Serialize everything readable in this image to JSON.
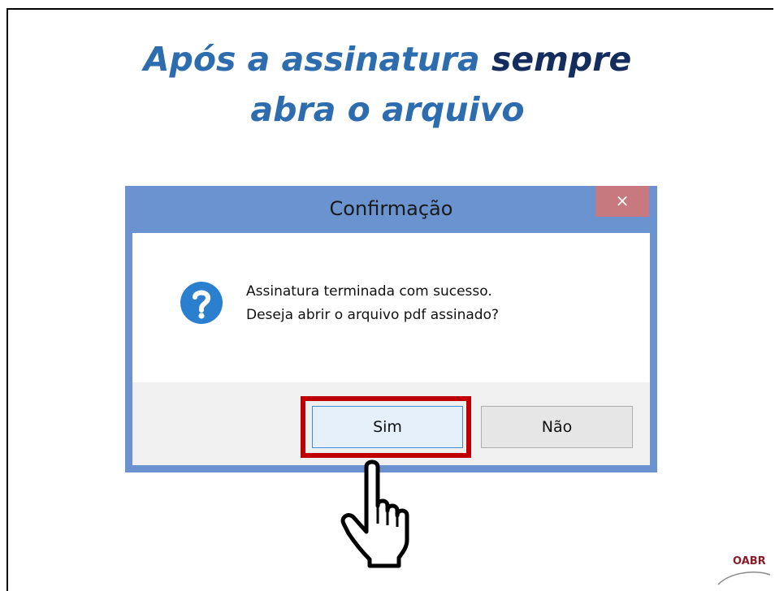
{
  "slide": {
    "title_part1": "Após a assinatura ",
    "title_emphasis": "sempre",
    "title_line2": "abra o arquivo"
  },
  "dialog": {
    "title": "Confirmação",
    "close_symbol": "×",
    "message_line1": "Assinatura terminada com sucesso.",
    "message_line2": "Deseja abrir o arquivo pdf assinado?",
    "icon": "question-icon",
    "yes_label": "Sim",
    "no_label": "Não"
  },
  "logo": {
    "text": "OABR"
  },
  "colors": {
    "title": "#2e6cb0",
    "title_emphasis": "#142c5e",
    "dialog_frame": "#6a93cf",
    "close_button": "#c7797f",
    "highlight_box": "#c00000",
    "question_icon": "#2a80cf"
  }
}
